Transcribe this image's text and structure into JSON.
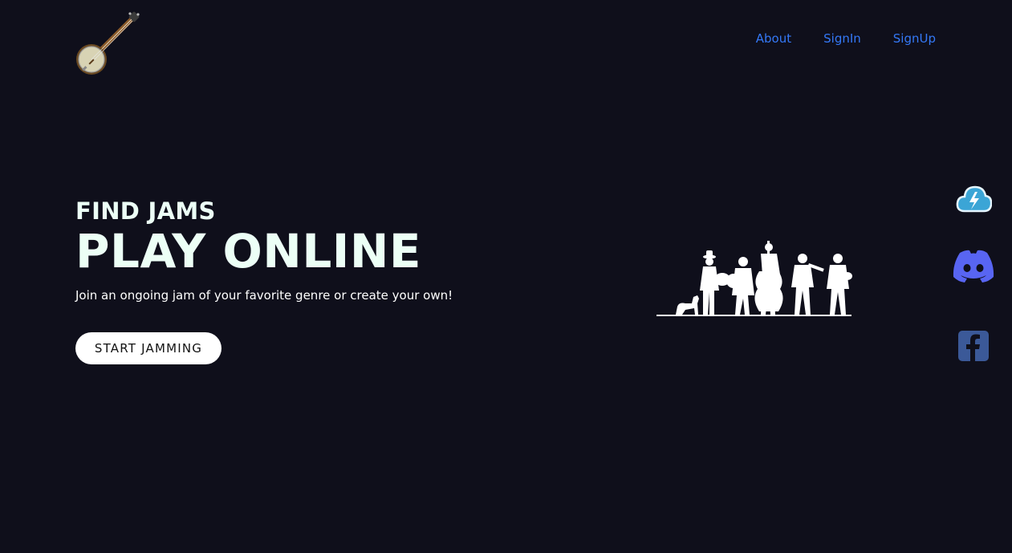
{
  "nav": {
    "about": "About",
    "signin": "SignIn",
    "signup": "SignUp"
  },
  "hero": {
    "kicker": "FIND JAMS",
    "title": "PLAY ONLINE",
    "subtitle": "Join an ongoing jam of your favorite genre or create your own!",
    "cta_label": "START JAMMING"
  },
  "icons": {
    "logo": "banjo-icon",
    "hero_image": "bluegrass-band-silhouette",
    "social": [
      "cloud-lightning-icon",
      "discord-icon",
      "facebook-icon"
    ]
  },
  "colors": {
    "background": "#0f0f1b",
    "nav_link": "#3478f6",
    "heading": "#ecfff6",
    "discord": "#5865f2",
    "facebook": "#3b5998"
  }
}
